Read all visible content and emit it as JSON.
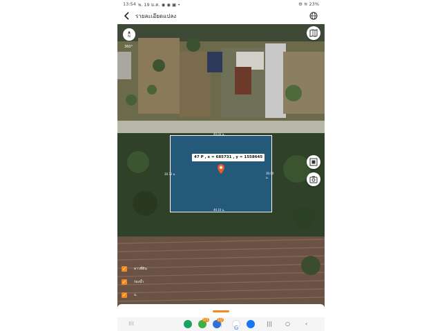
{
  "status_bar": {
    "time": "13:54",
    "notifications": "พ. 19 ม.ค. ◉ ◉ ▣ •",
    "system": "⚙ ≋ 23%"
  },
  "header": {
    "back_icon": "back-arrow-icon",
    "title": "รายละเอียดแปลง",
    "globe_icon": "globe-icon"
  },
  "map": {
    "compass_label": "A\nN",
    "scale_label": "360°",
    "parcel": {
      "coordinate_label": "47 P , x = 685731 , y = 1558645",
      "dim_top": "40.03 ม.",
      "dim_bottom": "40.10 ม.",
      "dim_left": "30.72 ม.",
      "dim_right": "30.00 ม.",
      "fill_color": "#1e6ebe",
      "pin_color": "#f05a28"
    },
    "layers": [
      {
        "label": "ดาวที่ดิน",
        "checked": true
      },
      {
        "label": "ร่องน้ำ",
        "checked": true
      },
      {
        "label": "ถ.",
        "checked": true
      }
    ]
  },
  "bottom_sheet": {
    "handle_color": "#f08a1c"
  },
  "nav_bar": {
    "apps_icon": "apps-grid-icon",
    "badge_1": "171",
    "badge_2": "137",
    "recent_icon": "recents-icon",
    "home_icon": "home-icon",
    "back_icon": "nav-back-icon"
  },
  "colors": {
    "accent": "#f08a1c"
  }
}
